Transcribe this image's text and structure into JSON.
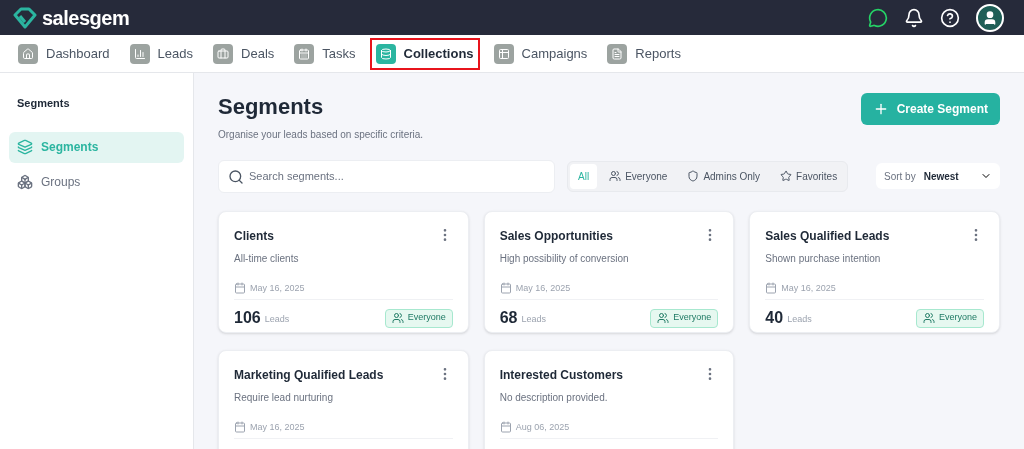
{
  "brand": {
    "name": "salesgem"
  },
  "nav": [
    {
      "label": "Dashboard",
      "selected": false,
      "highlighted": false
    },
    {
      "label": "Leads",
      "selected": false,
      "highlighted": false
    },
    {
      "label": "Deals",
      "selected": false,
      "highlighted": false
    },
    {
      "label": "Tasks",
      "selected": false,
      "highlighted": false
    },
    {
      "label": "Collections",
      "selected": true,
      "highlighted": true
    },
    {
      "label": "Campaigns",
      "selected": false,
      "highlighted": false
    },
    {
      "label": "Reports",
      "selected": false,
      "highlighted": false
    }
  ],
  "sidebar": {
    "title": "Segments",
    "items": [
      {
        "label": "Segments",
        "selected": true
      },
      {
        "label": "Groups",
        "selected": false
      }
    ]
  },
  "page": {
    "title": "Segments",
    "subtitle": "Organise your leads based on specific criteria.",
    "create_button": "Create Segment"
  },
  "search": {
    "placeholder": "Search segments..."
  },
  "filters": [
    {
      "label": "All",
      "selected": true
    },
    {
      "label": "Everyone",
      "selected": false
    },
    {
      "label": "Admins Only",
      "selected": false
    },
    {
      "label": "Favorites",
      "selected": false
    }
  ],
  "sort": {
    "label": "Sort by",
    "value": "Newest"
  },
  "cards": [
    {
      "title": "Clients",
      "description": "All-time clients",
      "date": "May 16, 2025",
      "count": "106",
      "unit": "Leads",
      "badge": "Everyone"
    },
    {
      "title": "Sales Opportunities",
      "description": "High possibility of conversion",
      "date": "May 16, 2025",
      "count": "68",
      "unit": "Leads",
      "badge": "Everyone"
    },
    {
      "title": "Sales Qualified Leads",
      "description": "Shown purchase intention",
      "date": "May 16, 2025",
      "count": "40",
      "unit": "Leads",
      "badge": "Everyone"
    },
    {
      "title": "Marketing Qualified Leads",
      "description": "Require lead nurturing",
      "date": "May 16, 2025"
    },
    {
      "title": "Interested Customers",
      "description": "No description provided.",
      "date": "Aug 06, 2025"
    }
  ]
}
